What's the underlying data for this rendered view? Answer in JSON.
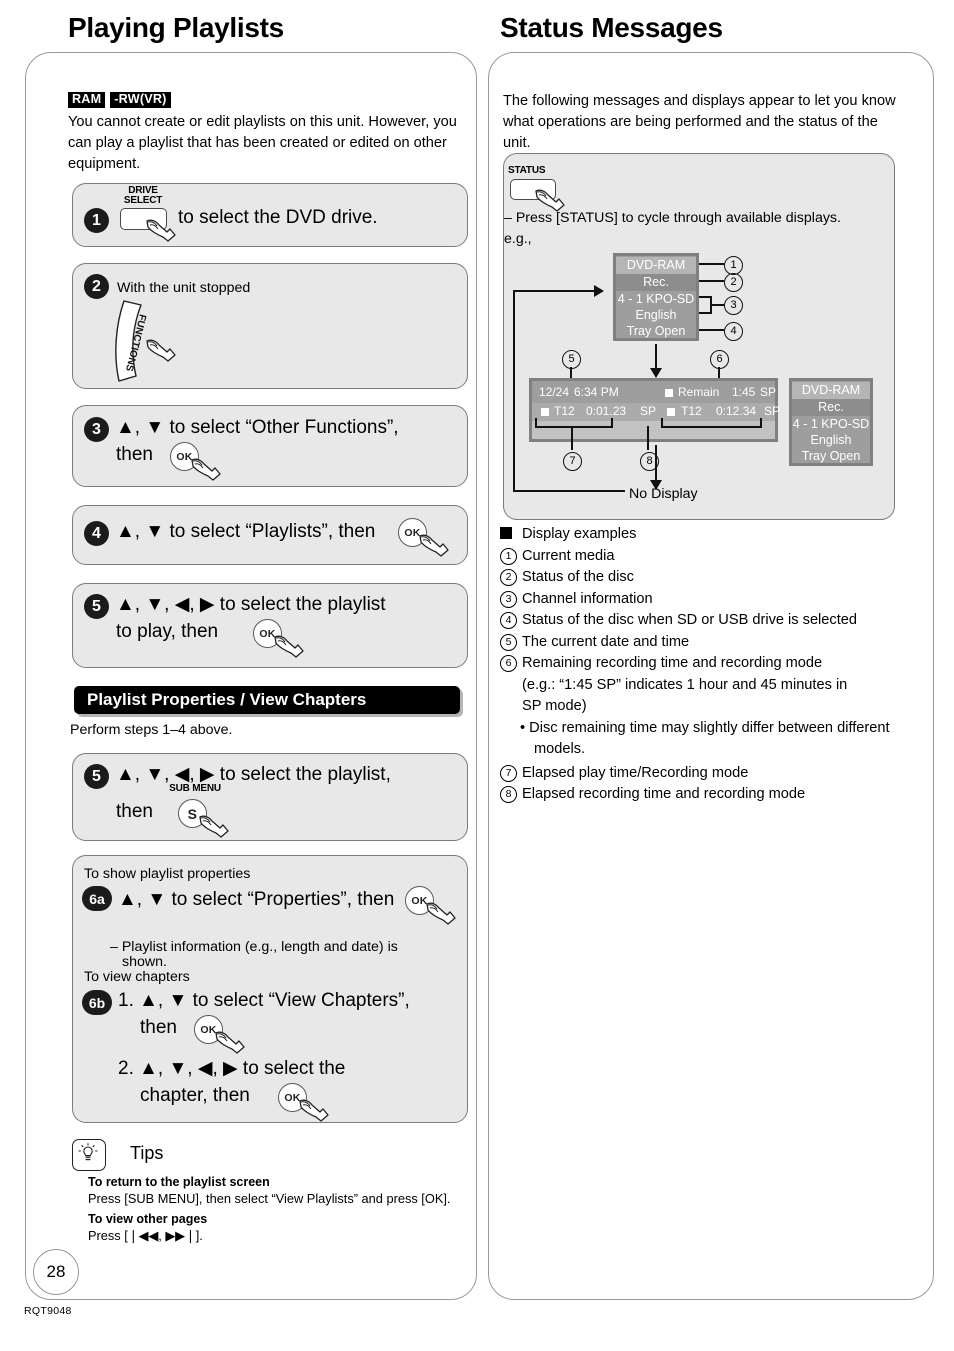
{
  "page": {
    "number": "28",
    "code": "RQT9048"
  },
  "left": {
    "title": "Playing Playlists",
    "badges": [
      "RAM",
      "-RW(VR)"
    ],
    "intro": "You cannot create or edit playlists on this unit. However, you can play a playlist that has been created or edited on other equipment.",
    "steps": [
      {
        "num": "1",
        "key_label_1": "DRIVE",
        "key_label_2": "SELECT",
        "text": "to select the DVD drive."
      },
      {
        "num": "2",
        "lead": "With the unit stopped",
        "key_label": "FUNCTIONS"
      },
      {
        "num": "3",
        "line1": "▲, ▼ to select “Other Functions”,",
        "line2": "then",
        "btn": "OK"
      },
      {
        "num": "4",
        "line1": "▲, ▼ to select “Playlists”, then",
        "btn": "OK"
      },
      {
        "num": "5",
        "line1": "▲, ▼, ◀, ▶ to select the playlist",
        "line2": "to play, then",
        "btn": "OK"
      }
    ],
    "section": {
      "bar_title": "Playlist Properties / View Chapters",
      "perform": "Perform steps 1–4 above.",
      "step5": {
        "num": "5",
        "line1": "▲, ▼, ◀, ▶ to select the playlist,",
        "line2": "then",
        "btn_label": "SUB MENU",
        "btn": "S"
      },
      "step6": {
        "heading_a": "To show playlist properties",
        "num_a": "6a",
        "a_line1": "▲, ▼ to select “Properties”, then",
        "a_btn": "OK",
        "a_note1": "– Playlist information (e.g., length and date) is",
        "a_note2": "shown.",
        "heading_b": "To view chapters",
        "num_b": "6b",
        "b1_line1": "1. ▲, ▼ to select “View Chapters”,",
        "b1_line2": "then",
        "b1_btn": "OK",
        "b2_line1": "2. ▲, ▼, ◀, ▶ to select the",
        "b2_line2": "chapter, then",
        "b2_btn": "OK"
      }
    },
    "tips": {
      "title": "Tips",
      "items": [
        {
          "head": "To return to the playlist screen",
          "body": "Press [SUB MENU], then select “View Playlists” and press [OK]."
        },
        {
          "head": "To view other pages",
          "body": "Press [❘◀◀, ▶▶❘]."
        }
      ]
    }
  },
  "right": {
    "title": "Status Messages",
    "intro": "The following messages and displays appear to let you know what operations are being performed and the status of the unit.",
    "status_button_label": "STATUS",
    "press_note": "– Press [STATUS] to cycle through available displays.",
    "eg": "e.g.,",
    "osd": {
      "panel_top": {
        "lines": [
          "DVD-RAM",
          "Rec.",
          "4 - 1 KPO-SD",
          "English",
          "Tray Open"
        ]
      },
      "panel_wide": {
        "date": "12/24",
        "time": "6:34 PM",
        "remain_label": "Remain",
        "remain_value": "1:45",
        "remain_mode": "SP",
        "left_title": "T12",
        "left_time": "0:01.23",
        "left_mode": "SP",
        "right_title": "T12",
        "right_time": "0:12.34",
        "right_mode": "SP"
      },
      "panel_side": {
        "lines": [
          "DVD-RAM",
          "Rec.",
          "4 - 1 KPO-SD",
          "English",
          "Tray Open"
        ]
      },
      "no_display": "No Display",
      "callouts": [
        "1",
        "2",
        "3",
        "4",
        "5",
        "6",
        "7",
        "8"
      ]
    },
    "examples": {
      "heading": "Display examples",
      "items": [
        "Current media",
        "Status of the disc",
        "Channel information",
        "Status of the disc when SD or USB drive is selected",
        "The current date and time",
        "Remaining recording time and recording mode"
      ],
      "item6_note1": "(e.g.: “1:45 SP” indicates 1 hour and 45 minutes in",
      "item6_note2": "SP mode)",
      "item6_bullet": "•  Disc remaining time may slightly differ between different models.",
      "item7": "Elapsed play time/Recording mode",
      "item8": "Elapsed recording time and recording mode"
    }
  },
  "colors": {
    "osd_panel_bg": "#9e9e9e",
    "osd_panel_border": "#808080",
    "osd_header_bg": "#b5b5b5",
    "osd_sub_bg": "#8d8d8d",
    "step_bg": "#e8e8e8",
    "accent_black": "#000000"
  }
}
